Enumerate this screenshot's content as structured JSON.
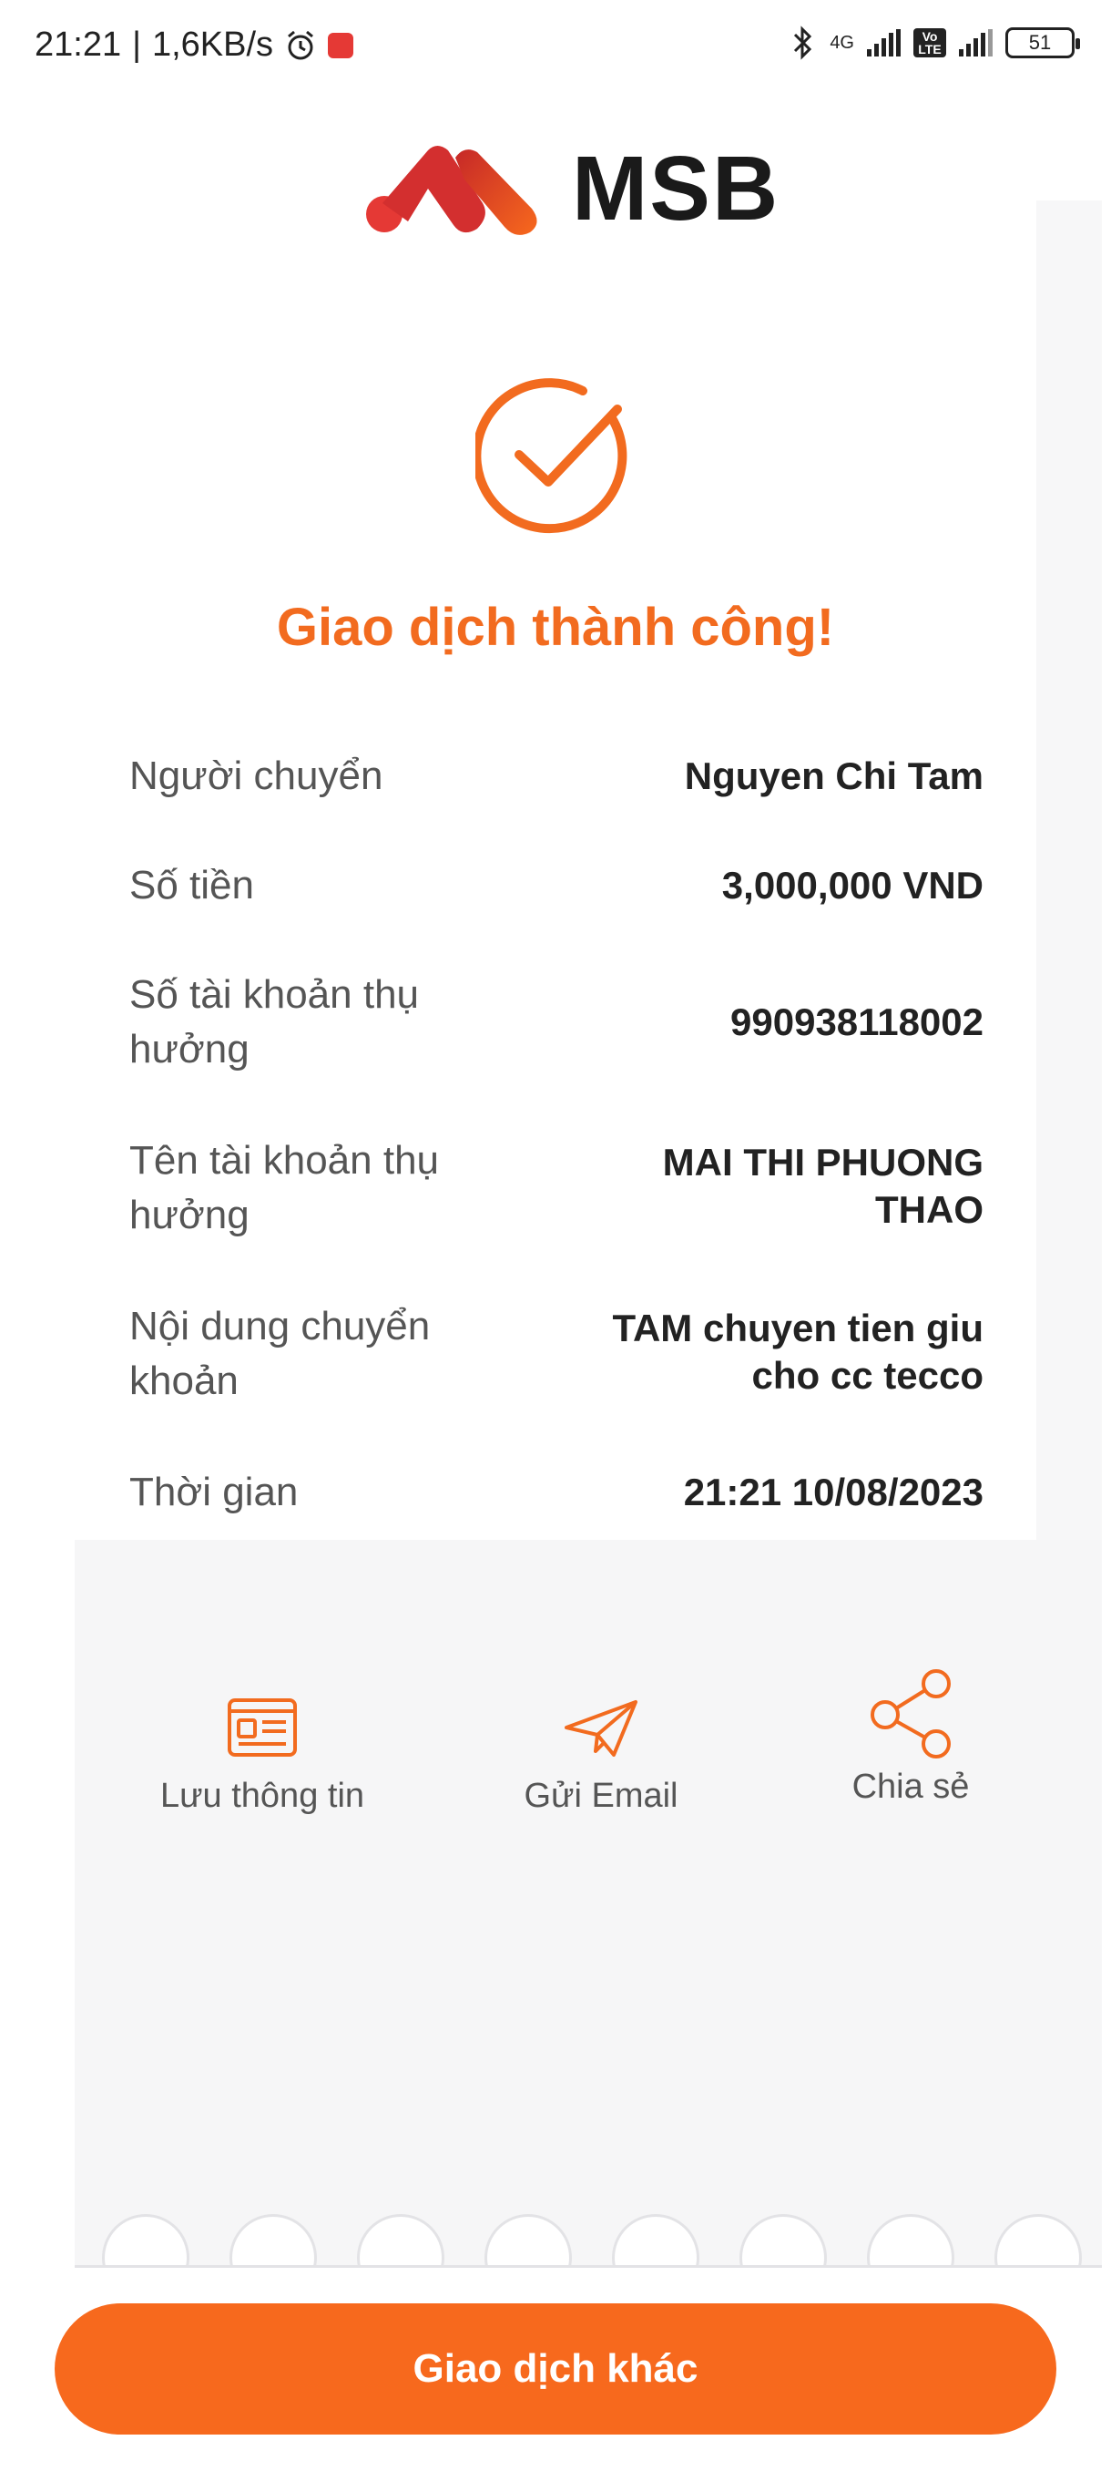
{
  "status_bar": {
    "time": "21:21",
    "network_speed": "1,6KB/s",
    "network_type": "4G",
    "volte": "Vo LTE",
    "battery": "51",
    "icons": [
      "alarm-icon",
      "notification-app-icon",
      "bluetooth-icon",
      "signal-icon",
      "volte-icon",
      "signal-icon",
      "battery-icon"
    ]
  },
  "brand": {
    "name": "MSB",
    "accent_color": "#f26b1f",
    "logo_colors": [
      "#e53935",
      "#f7691d"
    ]
  },
  "result": {
    "title": "Giao dịch thành công!",
    "icon": "check-circle-icon"
  },
  "details": [
    {
      "label": "Người chuyển",
      "value": "Nguyen Chi Tam"
    },
    {
      "label": "Số tiền",
      "value": "3,000,000 VND"
    },
    {
      "label": "Số tài khoản thụ hưởng",
      "value": "990938118002"
    },
    {
      "label": "Tên tài khoản thụ hưởng",
      "value": "MAI THI PHUONG THAO"
    },
    {
      "label": "Nội dung chuyển khoản",
      "value": "TAM chuyen tien giu cho cc tecco"
    },
    {
      "label": "Thời gian",
      "value": "21:21 10/08/2023"
    }
  ],
  "actions": [
    {
      "label": "Lưu thông tin",
      "icon": "save-info-icon"
    },
    {
      "label": "Gửi Email",
      "icon": "send-email-icon"
    },
    {
      "label": "Chia sẻ",
      "icon": "share-icon"
    }
  ],
  "footer": {
    "button_label": "Giao dịch khác"
  }
}
